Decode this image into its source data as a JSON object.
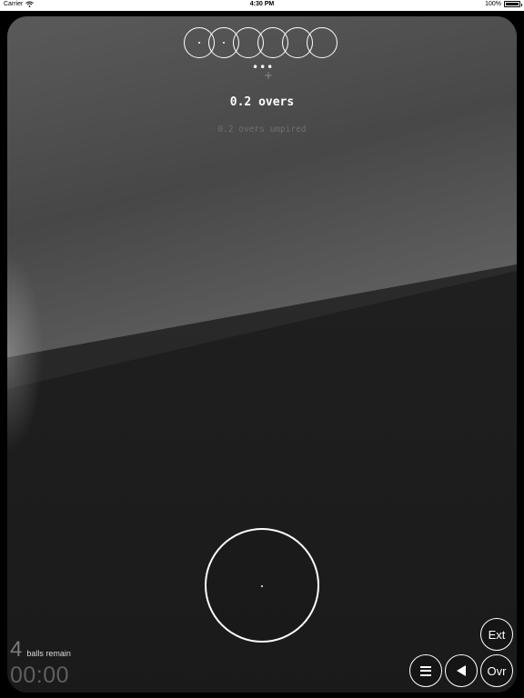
{
  "status_bar": {
    "carrier": "Carrier",
    "time": "4:30 PM",
    "battery": "100%",
    "battery_level": 1.0,
    "wifi_icon": "wifi-icon",
    "battery_icon": "battery-icon"
  },
  "over": {
    "balls": [
      {
        "marked": true
      },
      {
        "marked": true
      },
      {
        "marked": false
      },
      {
        "marked": false
      },
      {
        "marked": false
      },
      {
        "marked": false
      }
    ],
    "more_indicator": "•••",
    "add_icon": "plus-icon",
    "title": "0.2 overs",
    "subtitle": "0.2 overs umpired"
  },
  "main_ball": {
    "icon": "ball-icon"
  },
  "footer": {
    "balls_remaining_count": "4",
    "balls_remaining_label": "balls remain",
    "timer": "00:00"
  },
  "controls": {
    "extras_label": "Ext",
    "menu_icon": "menu-icon",
    "back_icon": "back-triangle-icon",
    "over_label": "Ovr"
  },
  "colors": {
    "foreground": "#ffffff",
    "subtitle": "#6e6e6e",
    "timer": "#5f5f5f",
    "background": "#000000"
  }
}
